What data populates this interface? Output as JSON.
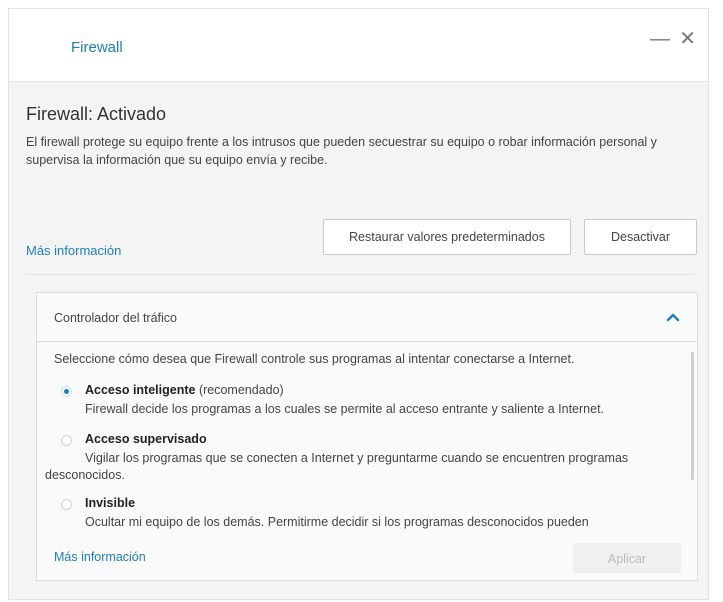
{
  "window": {
    "title": "Firewall",
    "minimize_label": "—",
    "close_label": "✕"
  },
  "status": {
    "heading": "Firewall: Activado",
    "description": "El firewall protege su equipo frente a los intrusos que pueden secuestrar su equipo o robar información personal y supervisa la información que su equipo envía y recibe."
  },
  "actions": {
    "more_info": "Más información",
    "restore_label": "Restaurar valores predeterminados",
    "deactivate_label": "Desactivar"
  },
  "traffic_panel": {
    "title": "Controlador del tráfico",
    "expanded": true,
    "intro": "Seleccione cómo desea que Firewall controle sus programas al intentar conectarse a Internet.",
    "options": [
      {
        "label": "Acceso inteligente",
        "suffix": "(recomendado)",
        "selected": true,
        "description": "Firewall decide los programas a los cuales se permite al acceso entrante y saliente a Internet."
      },
      {
        "label": "Acceso supervisado",
        "suffix": "",
        "selected": false,
        "description": "Vigilar los programas que se conecten a Internet y preguntarme cuando se encuentren programas desconocidos."
      },
      {
        "label": "Invisible",
        "suffix": "",
        "selected": false,
        "description": "Ocultar mi equipo de los demás. Permitirme decidir si los programas desconocidos pueden"
      }
    ],
    "more_info": "Más información",
    "apply_label": "Aplicar",
    "apply_enabled": false
  },
  "colors": {
    "accent": "#1b7fc1",
    "background": "#f4f4f4"
  }
}
